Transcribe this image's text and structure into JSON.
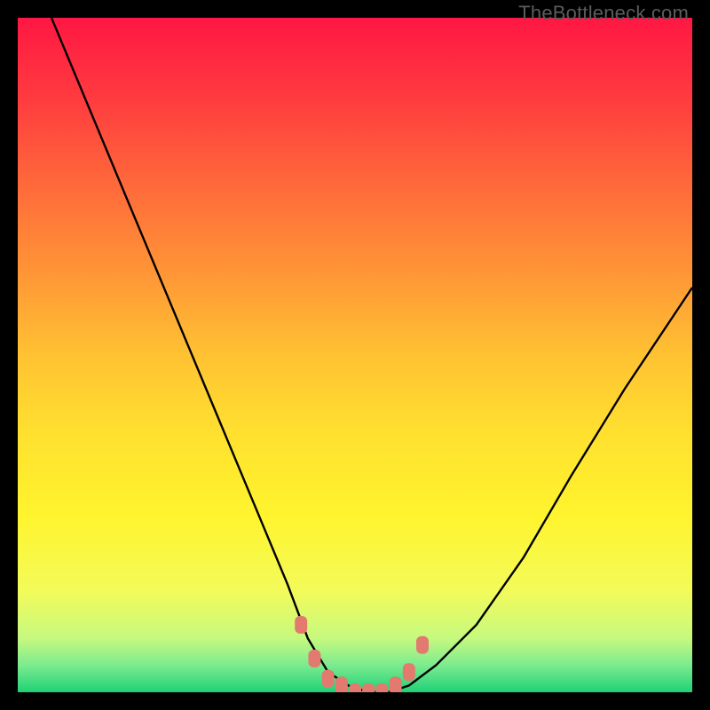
{
  "watermark": "TheBottleneck.com",
  "colors": {
    "background": "#000000",
    "curve_stroke": "#000000",
    "marker_fill": "#e27a6f",
    "watermark_text": "#5b5b5b"
  },
  "gradient_stops": [
    {
      "offset": 0.0,
      "color": "#ff1743"
    },
    {
      "offset": 0.12,
      "color": "#ff3b3f"
    },
    {
      "offset": 0.25,
      "color": "#ff6a3a"
    },
    {
      "offset": 0.38,
      "color": "#ff9636"
    },
    {
      "offset": 0.5,
      "color": "#ffc232"
    },
    {
      "offset": 0.62,
      "color": "#ffe12f"
    },
    {
      "offset": 0.74,
      "color": "#fff42e"
    },
    {
      "offset": 0.85,
      "color": "#f3fb5a"
    },
    {
      "offset": 0.92,
      "color": "#c6f97f"
    },
    {
      "offset": 0.96,
      "color": "#7ceb8f"
    },
    {
      "offset": 1.0,
      "color": "#1fd177"
    }
  ],
  "chart_data": {
    "type": "line",
    "title": "",
    "xlabel": "",
    "ylabel": "",
    "xlim": [
      0,
      100
    ],
    "ylim": [
      0,
      100
    ],
    "series": [
      {
        "name": "bottleneck-curve",
        "x": [
          5,
          10,
          15,
          20,
          25,
          30,
          35,
          40,
          43,
          46,
          49,
          52,
          55,
          58,
          62,
          68,
          75,
          82,
          90,
          100
        ],
        "y": [
          100,
          88,
          76,
          64,
          52,
          40,
          28,
          16,
          8,
          3,
          1,
          0,
          0,
          1,
          4,
          10,
          20,
          32,
          45,
          60
        ]
      }
    ],
    "markers": {
      "name": "highlight-band",
      "x": [
        42,
        44,
        46,
        48,
        50,
        52,
        54,
        56,
        58,
        60
      ],
      "y": [
        10,
        5,
        2,
        1,
        0,
        0,
        0,
        1,
        3,
        7
      ]
    }
  }
}
